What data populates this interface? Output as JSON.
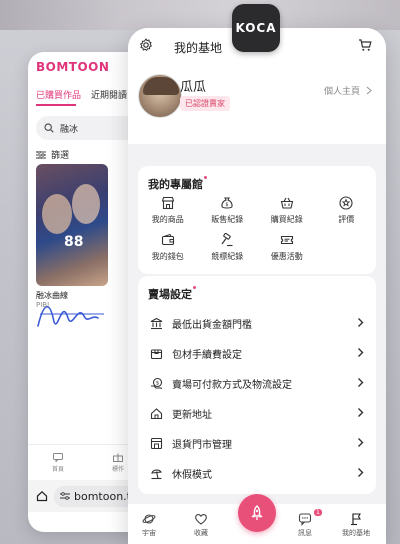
{
  "back_app": {
    "logo": "BOMTOON",
    "tabs": [
      "已購買作品",
      "近期閱讀"
    ],
    "search_value": "融冰",
    "filter_label": "篩選",
    "book": {
      "title": "融冰曲線",
      "author": "PIBI",
      "cover_number": "88"
    },
    "bottom_nav": [
      "首頁",
      "標作"
    ],
    "url": "bomtoon.tw"
  },
  "koca_badge": "KOCA",
  "header": {
    "title": "我的基地"
  },
  "profile": {
    "name": "瓜瓜",
    "badge": "已認證賣家",
    "home_link": "個人主頁"
  },
  "exclusive": {
    "title": "我的專屬館",
    "items": [
      {
        "label": "我的商品",
        "icon": "store-icon"
      },
      {
        "label": "販售紀錄",
        "icon": "money-bag-icon"
      },
      {
        "label": "購買紀錄",
        "icon": "basket-icon"
      },
      {
        "label": "評價",
        "icon": "star-badge-icon"
      },
      {
        "label": "我的錢包",
        "icon": "wallet-icon"
      },
      {
        "label": "競標紀錄",
        "icon": "gavel-icon"
      },
      {
        "label": "優惠活動",
        "icon": "ticket-icon"
      }
    ]
  },
  "settings": {
    "title": "賣場設定",
    "items": [
      {
        "label": "最低出貨金額門檻",
        "icon": "bank-icon"
      },
      {
        "label": "包材手續費設定",
        "icon": "package-icon"
      },
      {
        "label": "賣場可付款方式及物流設定",
        "icon": "payment-icon"
      },
      {
        "label": "更新地址",
        "icon": "home-icon"
      },
      {
        "label": "退貨門市管理",
        "icon": "shop-return-icon"
      },
      {
        "label": "休假模式",
        "icon": "beach-icon"
      }
    ]
  },
  "bottom_nav": {
    "items": [
      "宇宙",
      "收藏",
      "訊息",
      "我的基地"
    ],
    "badge_count": "1"
  },
  "colors": {
    "accent": "#e8507a",
    "bomtoon_pink": "#e0357a"
  }
}
